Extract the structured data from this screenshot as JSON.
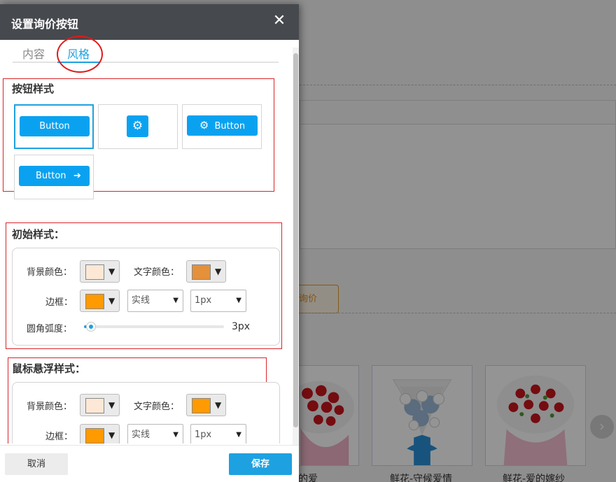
{
  "dialog": {
    "title": "设置询价按钮",
    "close_glyph": "✕",
    "tabs": [
      {
        "label": "内容",
        "active": false
      },
      {
        "label": "风格",
        "active": true
      }
    ]
  },
  "button_style": {
    "title": "按钮样式",
    "options": [
      {
        "label": "Button",
        "icon": "none",
        "selected": true
      },
      {
        "label": "",
        "icon": "gear-icon",
        "selected": false
      },
      {
        "label": "Button",
        "icon": "gear-icon",
        "selected": false
      },
      {
        "label": "Button",
        "icon": "arrow-right-icon",
        "selected": false
      }
    ],
    "gear_glyph": "⚙",
    "arrow_glyph": "➔"
  },
  "initial_style": {
    "title": "初始样式：",
    "bg_color_label": "背景颜色：",
    "bg_color": "#fde8d6",
    "text_color_label": "文字颜色：",
    "text_color": "#e5903a",
    "border_label": "边框：",
    "border_color": "#ff9a00",
    "border_style": "实线",
    "border_width": "1px",
    "radius_label": "圆角弧度：",
    "radius_value": "3px",
    "radius_fraction": 0.05
  },
  "hover_style": {
    "title": "鼠标悬浮样式：",
    "bg_color_label": "背景颜色：",
    "bg_color": "#fde8d6",
    "text_color_label": "文字颜色：",
    "text_color": "#ff9a00",
    "border_label": "边框：",
    "border_color": "#ff9a00",
    "border_style": "实线",
    "border_width": "1px"
  },
  "footer": {
    "cancel_label": "取消",
    "save_label": "保存"
  },
  "background": {
    "inquiry_button_label": "询价",
    "products": [
      {
        "caption": "热烈的爱"
      },
      {
        "caption": "鲜花-守候爱情"
      },
      {
        "caption": "鲜花-爱的嫁纱"
      }
    ],
    "next_glyph": "›"
  },
  "colors": {
    "accent": "#1ea1e0",
    "button_blue": "#0aa2f0",
    "header_bg": "#46494e",
    "annotation_red": "#d9252a"
  },
  "select_arrow": "▼"
}
